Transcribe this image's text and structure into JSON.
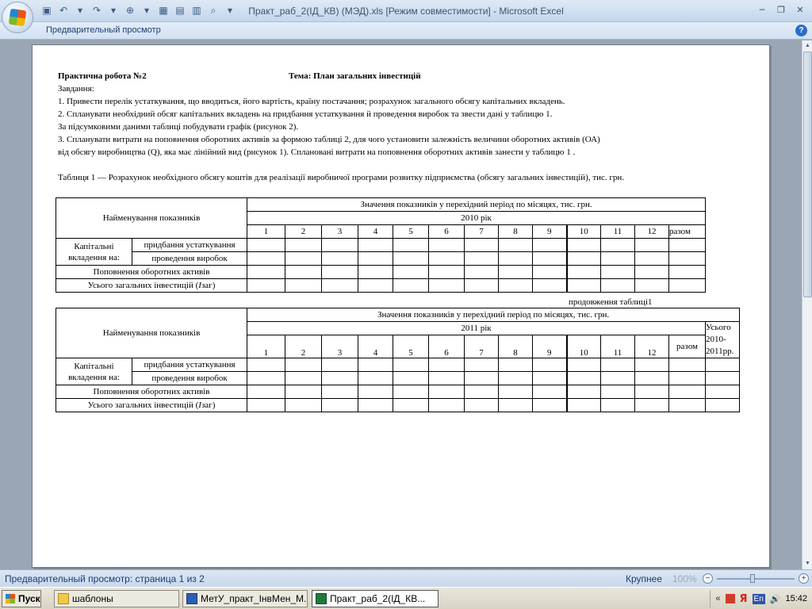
{
  "window": {
    "title": "Практ_раб_2(ІД_КВ) (МЭД).xls  [Режим совместимости] - Microsoft Excel",
    "ribbon_title": "Предварительный просмотр"
  },
  "doc": {
    "heading": "Практична робота №2",
    "theme": "Тема: План загальних інвестицій",
    "lines": [
      "Завдання:",
      "1. Привести перелік устаткування, що вводиться, його вартість, країну постачання; розрахунок загального обсягу капітальних вкладень.",
      "2. Спланувати необхідний обсяг капітальних вкладень на придбання устаткування й проведення виробок та звести дані у  таблицю 1.",
      "За підсумковими даними таблиці  побудувати графік (рисунок 2).",
      "3. Спланувати витрати на поповнення оборотних  активів за формою таблиці 2, для чого установити залежність величини оборотних  активів (ОА)",
      "від обсягу виробництва (Q), яка має лінійний  вид (рисунок 1).  Сплановані витрати на поповнення оборотних  активів занести у таблицю 1 ."
    ],
    "table_caption": "Таблиця 1 — Розрахунок необхідного обсягу коштів для реалізації виробничої програми розвитку підприємства (обсягу загальних інвестицій), тис. грн.",
    "continuation": "продовження таблиці1"
  },
  "table1": {
    "name_header": "Найменування показників",
    "span_header": "Значення показників у перехідний період по місяцях, тис. грн.",
    "year": "2010 рік",
    "months": [
      "1",
      "2",
      "3",
      "4",
      "5",
      "6",
      "7",
      "8",
      "9",
      "10",
      "11",
      "12"
    ],
    "total": "разом",
    "rows": {
      "capital": "Капітальні вкладення на:",
      "equipment": "придбання устаткування",
      "works": "проведення виробок",
      "working_assets": "Поповнення оборотних  активів",
      "total_prefix": "Усього загальних інвестицій (",
      "total_var": "I",
      "total_suffix": "заг)"
    }
  },
  "table2": {
    "name_header": "Найменування показників",
    "span_header": "Значення показників у перехідний період по місяцях, тис. грн.",
    "year": "2011 рік",
    "months": [
      "1",
      "2",
      "3",
      "4",
      "5",
      "6",
      "7",
      "8",
      "9",
      "10",
      "11",
      "12"
    ],
    "total": "разом",
    "grand_total": "Усього 2010-2011рр.",
    "rows": {
      "capital": "Капітальні вкладення на:",
      "equipment": "придбання устаткування",
      "works": "проведення виробок",
      "working_assets": "Поповнення оборотних  активів",
      "total_prefix": "Усього загальних інвестицій (",
      "total_var": "I",
      "total_suffix": "заг)"
    }
  },
  "status": {
    "text": "Предварительный просмотр: страница 1 из 2",
    "zoom_label": "Крупнее",
    "zoom_pct": "100%"
  },
  "taskbar": {
    "start": "Пуск",
    "tasks": [
      "шаблоны",
      "МетУ_практ_ІнвМен_М...",
      "Практ_раб_2(ІД_КВ..."
    ],
    "lang": "En",
    "clock": "15:42"
  }
}
